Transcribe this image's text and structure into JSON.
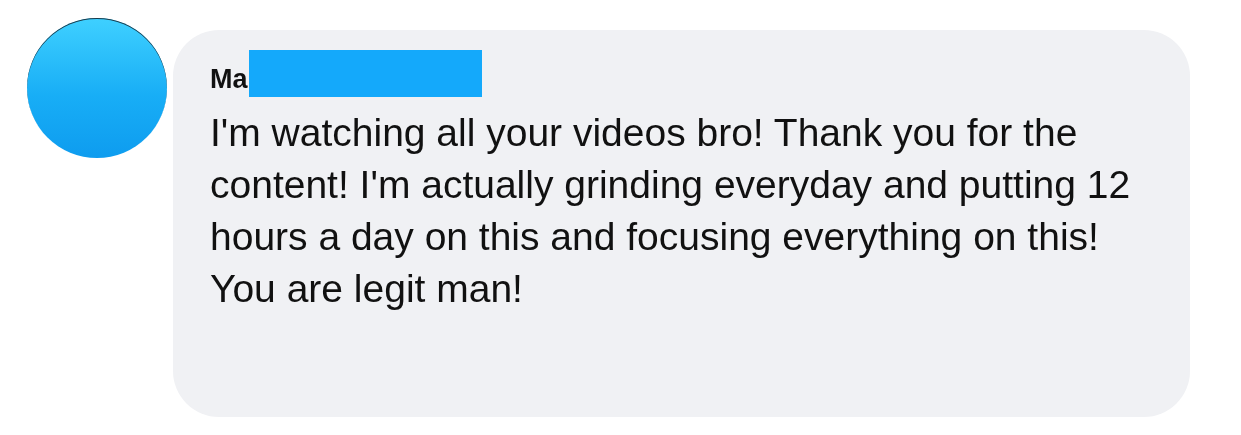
{
  "comment": {
    "author": "Ma",
    "author_redacted": true,
    "text": "I'm watching all your videos bro! Thank you for the content! I'm actually grinding everyday and putting 12 hours a day on this and focusing everything on this! You are legit man!"
  }
}
